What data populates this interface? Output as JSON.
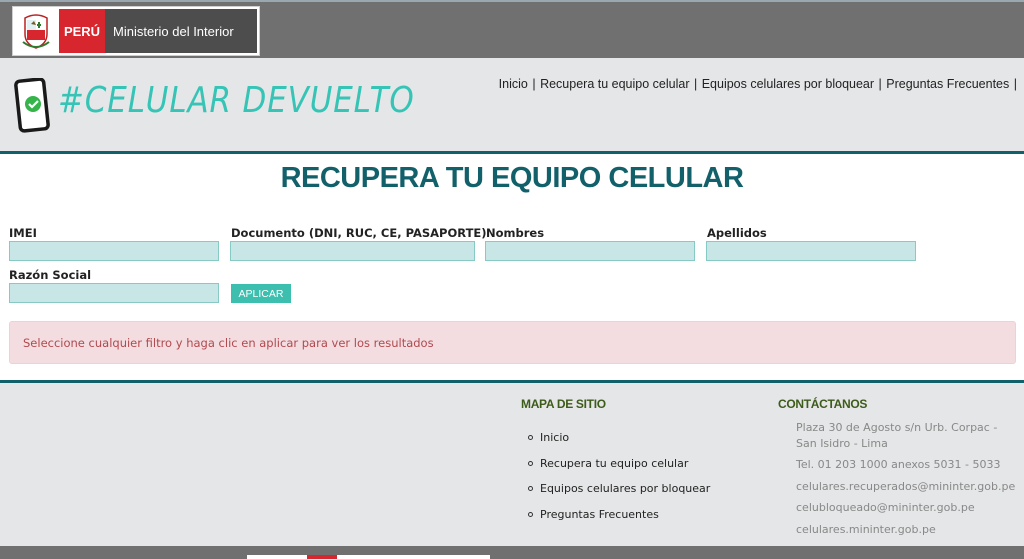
{
  "gov_bar": {
    "country": "PERÚ",
    "ministry": "Ministerio del Interior"
  },
  "header": {
    "brand": "#CELULAR DEVUELTO",
    "nav": [
      {
        "label": "Inicio"
      },
      {
        "label": "Recupera tu equipo celular"
      },
      {
        "label": "Equipos celulares por bloquear"
      },
      {
        "label": "Preguntas Frecuentes"
      }
    ],
    "separator": "|"
  },
  "main": {
    "title": "RECUPERA TU EQUIPO CELULAR",
    "fields": {
      "imei": {
        "label": "IMEI",
        "value": ""
      },
      "documento": {
        "label": "Documento (DNI, RUC, CE, PASAPORTE)",
        "value": ""
      },
      "nombres": {
        "label": "Nombres",
        "value": ""
      },
      "apellidos": {
        "label": "Apellidos",
        "value": ""
      },
      "razon_social": {
        "label": "Razón Social",
        "value": ""
      }
    },
    "apply_label": "APLICAR",
    "alert": "Seleccione cualquier filtro y haga clic en aplicar para ver los resultados"
  },
  "footer": {
    "sitemap_heading": "MAPA DE SITIO",
    "sitemap": [
      "Inicio",
      "Recupera tu equipo celular",
      "Equipos celulares por bloquear",
      "Preguntas Frecuentes"
    ],
    "contact_heading": "CONTÁCTANOS",
    "address_line1": "Plaza 30 de Agosto s/n Urb. Corpac -",
    "address_line2": "San Isidro - Lima",
    "phone": "Tel. 01 203 1000 anexos 5031 - 5033",
    "email1": "celulares.recuperados@mininter.gob.pe",
    "email2": "celubloqueado@mininter.gob.pe",
    "website": "celulares.mininter.gob.pe"
  },
  "colors": {
    "brand_teal": "#35c4b5",
    "title_teal": "#12606a",
    "gov_red": "#d7262d",
    "alert_bg": "#f4dde0"
  },
  "icons": [
    "peru-coat-of-arms-icon",
    "phone-check-icon",
    "bullet-icon"
  ]
}
